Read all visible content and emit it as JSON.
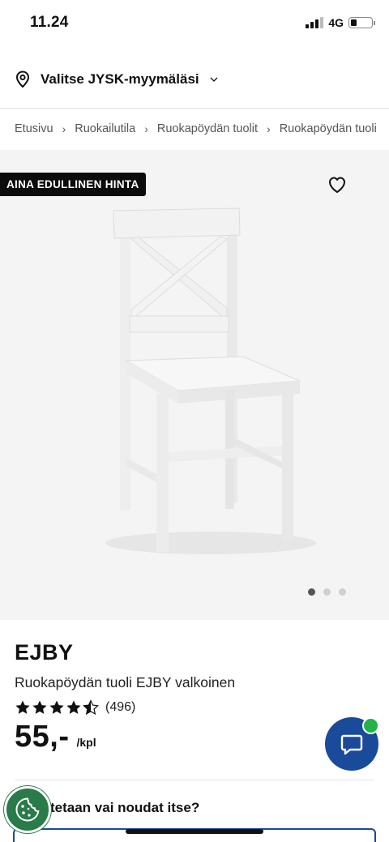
{
  "status_bar": {
    "time": "11.24",
    "network": "4G"
  },
  "store": {
    "label": "Valitse JYSK-myymäläsi",
    "icon": "location-pin-icon"
  },
  "breadcrumb": {
    "items": [
      "Etusivu",
      "Ruokailutila",
      "Ruokapöydän tuolit",
      "Ruokapöydän tuoli"
    ],
    "separator": "›"
  },
  "gallery": {
    "badge": "AINA EDULLINEN HINTA",
    "image_count": 3,
    "active_index": 0,
    "product_color": "#f7f7f7"
  },
  "product": {
    "brand": "EJBY",
    "name": "Ruokapöydän tuoli EJBY valkoinen",
    "rating": 4.5,
    "max_rating": 5,
    "review_count": "(496)",
    "price": "55,-",
    "unit": "/kpl"
  },
  "delivery": {
    "heading": "Toimitetaan vai noudat itse?",
    "heading_visible": "tetaan vai noudat itse?"
  },
  "colors": {
    "brand_blue": "#1a4a9a",
    "online_green": "#22b24a",
    "cookie_green": "#2a7a4a",
    "badge_bg": "#0c0c0c"
  }
}
